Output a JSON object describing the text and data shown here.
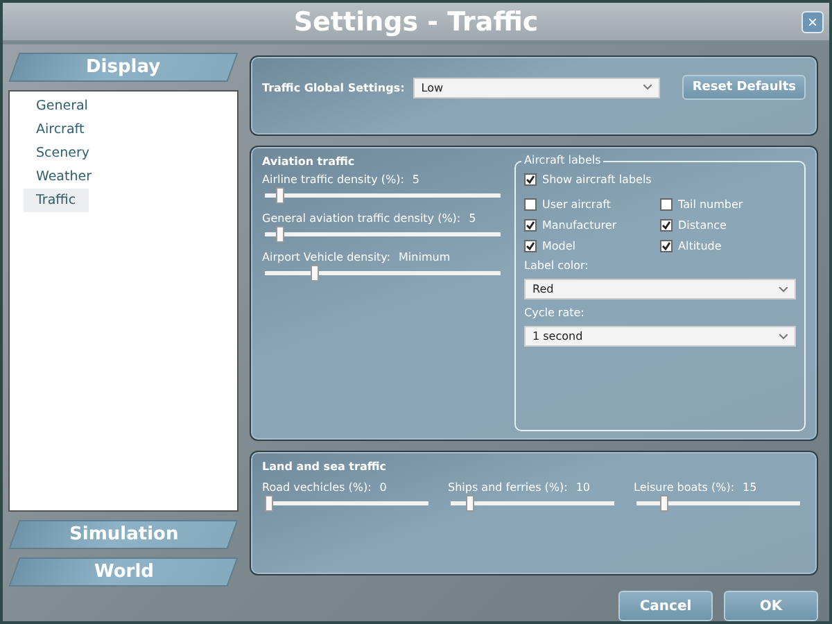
{
  "window": {
    "title": "Settings - Traffic",
    "close": "×"
  },
  "sidebar": {
    "sections": [
      {
        "label": "Display",
        "items": [
          {
            "label": "General",
            "selected": false
          },
          {
            "label": "Aircraft",
            "selected": false
          },
          {
            "label": "Scenery",
            "selected": false
          },
          {
            "label": "Weather",
            "selected": false
          },
          {
            "label": "Traffic",
            "selected": true
          }
        ]
      },
      {
        "label": "Simulation"
      },
      {
        "label": "World"
      }
    ]
  },
  "global": {
    "label": "Traffic Global Settings:",
    "value": "Low",
    "reset": "Reset Defaults"
  },
  "aviation": {
    "title": "Aviation traffic",
    "sliders": [
      {
        "label": "Airline traffic density (%):",
        "reading": "5",
        "level": 0.05
      },
      {
        "label": "General aviation traffic density (%):",
        "reading": "5",
        "level": 0.05
      },
      {
        "label": "Airport Vehicle density:",
        "reading": "Minimum",
        "level": 0.2
      }
    ],
    "labels": {
      "title": "Aircraft labels",
      "show": {
        "label": "Show aircraft labels",
        "checked": true
      },
      "options": [
        {
          "label": "User aircraft",
          "checked": false
        },
        {
          "label": "Tail number",
          "checked": false
        },
        {
          "label": "Manufacturer",
          "checked": true
        },
        {
          "label": "Distance",
          "checked": true
        },
        {
          "label": "Model",
          "checked": true
        },
        {
          "label": "Altitude",
          "checked": true
        }
      ],
      "selects": [
        {
          "label": "Label color:",
          "value": "Red"
        },
        {
          "label": "Cycle rate:",
          "value": "1 second"
        }
      ]
    }
  },
  "land_sea": {
    "title": "Land and sea traffic",
    "sliders": [
      {
        "label": "Road vechicles (%):",
        "reading": "0",
        "level": 0
      },
      {
        "label": "Ships and ferries (%):",
        "reading": "10",
        "level": 0.1
      },
      {
        "label": "Leisure boats (%):",
        "reading": "15",
        "level": 0.15
      }
    ]
  },
  "buttons": [
    "Cancel",
    "OK"
  ]
}
